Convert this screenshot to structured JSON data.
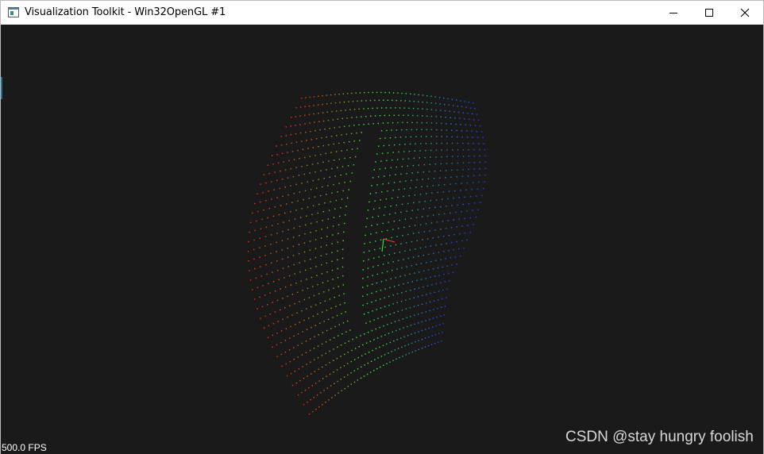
{
  "window": {
    "title": "Visualization Toolkit - Win32OpenGL #1",
    "app_icon": "vtk-window-icon",
    "controls": {
      "minimize_icon": "minimize-icon",
      "maximize_icon": "maximize-icon",
      "close_icon": "close-icon"
    }
  },
  "viewport": {
    "background": "#1a1a1a",
    "fps_text": "500.0 FPS",
    "watermark": "CSDN @stay hungry foolish",
    "point_colors": [
      "#ff2a1a",
      "#33ff33",
      "#2a3aff"
    ]
  }
}
